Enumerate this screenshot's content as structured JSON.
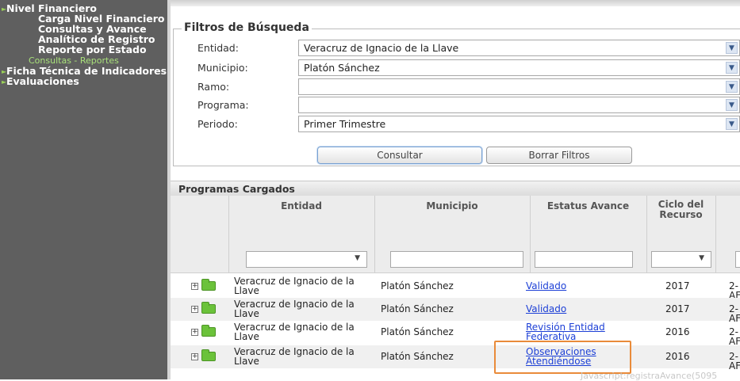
{
  "sidebar": {
    "items": [
      {
        "label": "Nivel Financiero",
        "level": "top"
      },
      {
        "label": "Carga Nivel Financiero",
        "level": "sub"
      },
      {
        "label": "Consultas y Avance",
        "level": "sub"
      },
      {
        "label": "Analítico de Registro",
        "level": "sub"
      },
      {
        "label": "Reporte por Estado",
        "level": "sub"
      },
      {
        "label": "Consultas - Reportes",
        "level": "link"
      },
      {
        "label": "Ficha Técnica de Indicadores",
        "level": "top"
      },
      {
        "label": "Evaluaciones",
        "level": "top"
      }
    ]
  },
  "filters": {
    "legend": "Filtros de Búsqueda",
    "fields": [
      {
        "label": "Entidad:",
        "value": "Veracruz de Ignacio de la Llave"
      },
      {
        "label": "Municipio:",
        "value": "Platón Sánchez"
      },
      {
        "label": "Ramo:",
        "value": ""
      },
      {
        "label": "Programa:",
        "value": ""
      },
      {
        "label": "Periodo:",
        "value": "Primer Trimestre"
      }
    ],
    "consultar_label": "Consultar",
    "borrar_label": "Borrar Filtros"
  },
  "grid": {
    "title": "Programas Cargados",
    "columns": {
      "entidad": "Entidad",
      "municipio": "Municipio",
      "estatus": "Estatus Avance",
      "ciclo_line1": "Ciclo del",
      "ciclo_line2": "Recurso"
    },
    "rows": [
      {
        "entidad_1": "Veracruz de Ignacio de la",
        "entidad_2": "Llave",
        "municipio": "Platón Sánchez",
        "estatus_1": "Validado",
        "estatus_2": "",
        "ciclo": "2017",
        "extra": "2-AF"
      },
      {
        "entidad_1": "Veracruz de Ignacio de la",
        "entidad_2": "Llave",
        "municipio": "Platón Sánchez",
        "estatus_1": "Validado",
        "estatus_2": "",
        "ciclo": "2017",
        "extra": "2-AF"
      },
      {
        "entidad_1": "Veracruz de Ignacio de la",
        "entidad_2": "Llave",
        "municipio": "Platón Sánchez",
        "estatus_1": "Revisión Entidad",
        "estatus_2": "Federativa",
        "ciclo": "2016",
        "extra": "2-AF"
      },
      {
        "entidad_1": "Veracruz de Ignacio de la",
        "entidad_2": "Llave",
        "municipio": "Platón Sánchez",
        "estatus_1": "Observaciones",
        "estatus_2": "Atendiéndose",
        "ciclo": "2016",
        "extra": "2-AF"
      }
    ]
  },
  "status_bar_text": "Javascript:registraAvance(5095",
  "colors": {
    "highlight": "#e98b3a",
    "link": "#1c3fd6",
    "sidebar_bg": "#5f5f5f"
  }
}
